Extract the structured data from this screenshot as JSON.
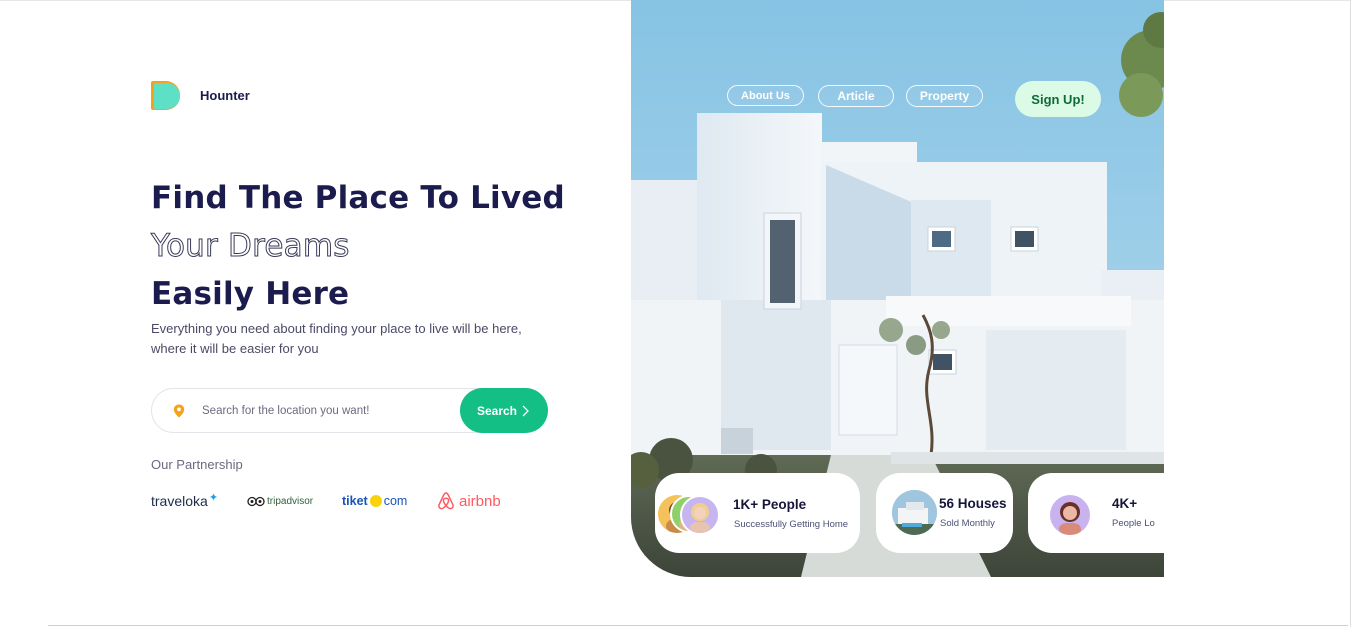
{
  "brand": {
    "name": "Hounter"
  },
  "hero": {
    "line1": "Find The Place To Lived",
    "line2": "Your Dreams",
    "line3": "Easily Here",
    "subtitle": "Everything you need about finding your place to live will be here, where it will be easier for you"
  },
  "search": {
    "placeholder": "Search for the location you want!",
    "value": "",
    "button_label": "Search",
    "icon": "location-pin-icon"
  },
  "partnership": {
    "title": "Our Partnership",
    "partners": [
      {
        "name": "traveloka",
        "icon": "traveloka-logo"
      },
      {
        "name": "tripadvisor",
        "icon": "tripadvisor-logo"
      },
      {
        "name_a": "tiket",
        "name_b": "com",
        "icon": "tiket-logo"
      },
      {
        "name": "airbnb",
        "icon": "airbnb-logo"
      }
    ]
  },
  "nav": {
    "items": [
      "About Us",
      "Article",
      "Property"
    ],
    "signup_label": "Sign Up!"
  },
  "stats": [
    {
      "value": "1K+ People",
      "label": "Successfully Getting Home"
    },
    {
      "value": "56 Houses",
      "label": "Sold Monthly"
    },
    {
      "value": "4K+",
      "label": "People Lo"
    }
  ],
  "colors": {
    "primary_text": "#1b1b4d",
    "accent_green": "#13bf85",
    "signup_bg": "#dcfbe6",
    "signup_text": "#0f6a3a",
    "logo_teal": "#5ee0c6",
    "logo_orange": "#f2a31b",
    "sky": "#8cc8e6"
  }
}
